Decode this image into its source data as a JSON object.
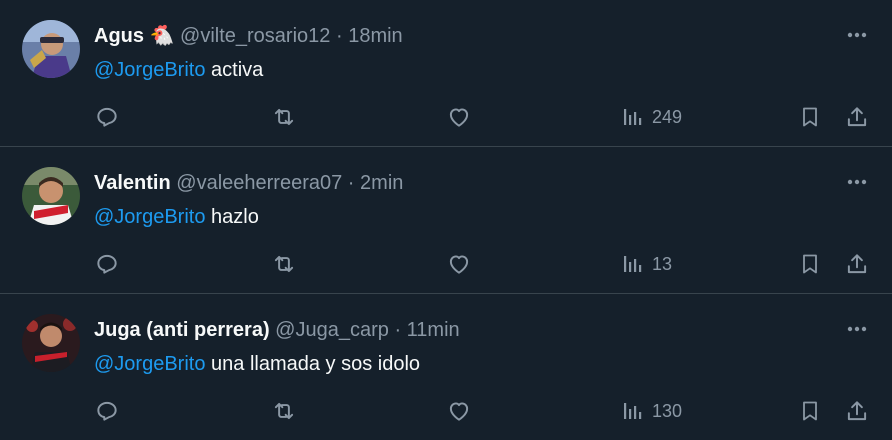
{
  "colors": {
    "background": "#15202b",
    "text": "#f7f9f9",
    "muted": "#8b98a5",
    "mention": "#1d9bf0",
    "divider": "#38444d"
  },
  "tweets": [
    {
      "name": "Agus 🐔",
      "handle": "@vilte_rosario12",
      "time": "18min",
      "mention": "@JorgeBrito",
      "text": "activa",
      "views": "249"
    },
    {
      "name": "Valentin",
      "handle": "@valeeherreera07",
      "time": "2min",
      "mention": "@JorgeBrito",
      "text": "hazlo",
      "views": "13"
    },
    {
      "name": "Juga (anti perrera)",
      "handle": "@Juga_carp",
      "time": "11min",
      "mention": "@JorgeBrito",
      "text": "una llamada y sos idolo",
      "views": "130"
    }
  ],
  "icons": {
    "reply": "reply-icon",
    "retweet": "retweet-icon",
    "like": "heart-icon",
    "views": "views-chart-icon",
    "bookmark": "bookmark-icon",
    "share": "share-icon",
    "more": "more-dots-icon"
  }
}
